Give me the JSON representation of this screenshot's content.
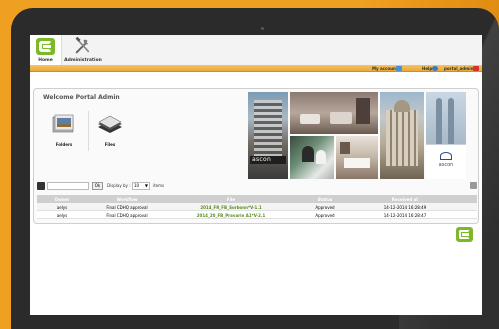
{
  "nav": {
    "tabs": [
      {
        "label": "Home",
        "icon": "home-logo-icon"
      },
      {
        "label": "Administration",
        "icon": "tools-icon"
      }
    ]
  },
  "userbar": {
    "my_account": "My account",
    "help": "Help",
    "user": "portal_admin"
  },
  "main": {
    "welcome": "Welcome Portal Admin",
    "tiles": [
      {
        "label": "Folders",
        "icon": "folders-icon"
      },
      {
        "label": "Files",
        "icon": "files-icon"
      }
    ],
    "photo_brand": "ascon",
    "photo_brand_sub": "ascon"
  },
  "toolbar": {
    "search_value": "",
    "ok_label": "Ok",
    "display_by_label": "Display by :",
    "display_count": "10",
    "items_label": "items"
  },
  "table": {
    "headers": [
      "Owner",
      "Workflow",
      "File",
      "Status",
      "Received at",
      ""
    ],
    "rows": [
      {
        "owner": "aelys",
        "workflow": "Final CDHQ approval",
        "file": "2014_FR_FB_Sorbonn*V-1.1",
        "status": "Approved",
        "received": "14-12-2014 16:28:49"
      },
      {
        "owner": "aelys",
        "workflow": "Final CDHQ approval",
        "file": "2014_20_FB_Pravarin A1*V-2.1",
        "status": "Approved",
        "received": "14-12-2014 16:28:47"
      }
    ]
  },
  "colors": {
    "brand_green": "#7cb928",
    "accent_orange": "#f0a020",
    "userbar": "#e9a93a"
  }
}
